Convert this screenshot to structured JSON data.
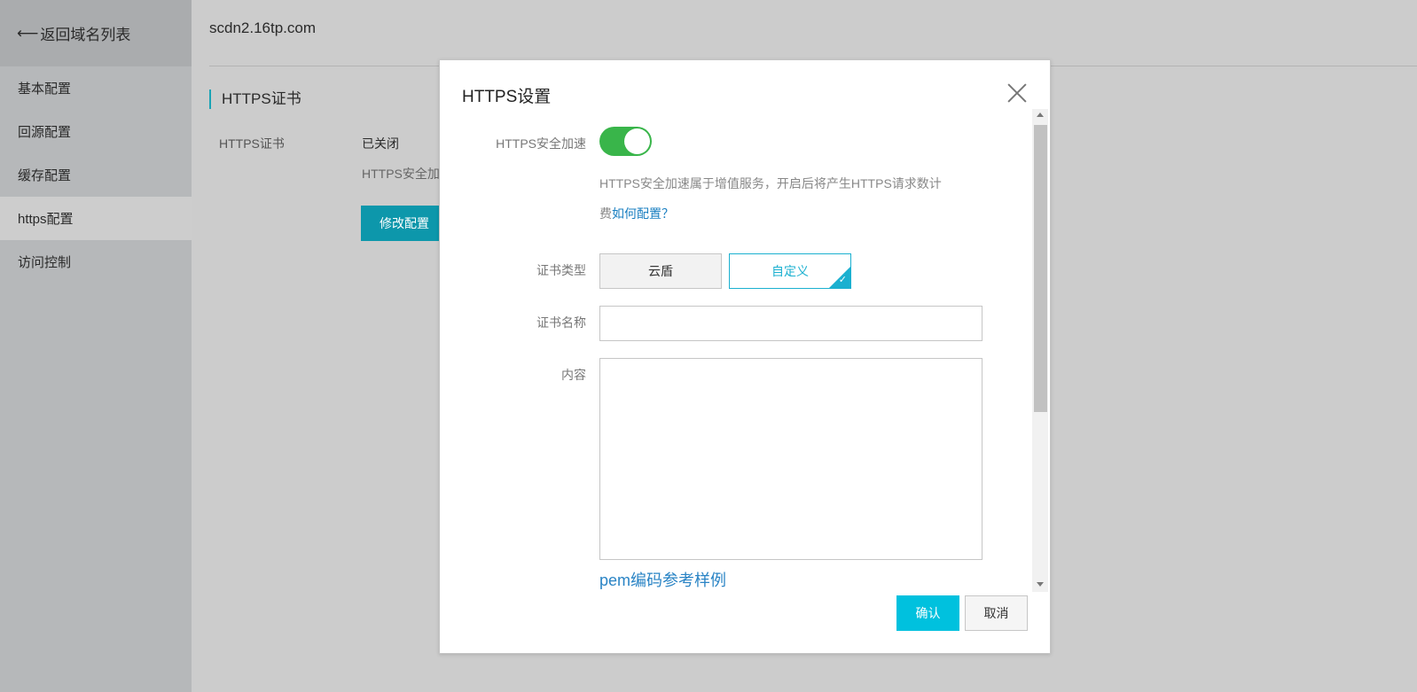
{
  "sidebar": {
    "back_arrow": "⟵",
    "back_label": "返回域名列表",
    "items": [
      {
        "label": "基本配置"
      },
      {
        "label": "回源配置"
      },
      {
        "label": "缓存配置"
      },
      {
        "label": "https配置"
      },
      {
        "label": "访问控制"
      }
    ],
    "active_index": 3
  },
  "main": {
    "domain": "scdn2.16tp.com",
    "section_title": "HTTPS证书",
    "row_label": "HTTPS证书",
    "row_value": "已关闭",
    "row_desc": "HTTPS安全加",
    "edit_button": "修改配置"
  },
  "modal": {
    "title": "HTTPS设置",
    "https_label": "HTTPS安全加速",
    "https_enabled": true,
    "help_text": "HTTPS安全加速属于增值服务，开启后将产生HTTPS请求数计费",
    "help_text_line1": "HTTPS安全加速属于增值服务，开启后将产生HTTPS请求数计",
    "help_text_line2": "费",
    "help_link": "如何配置？",
    "cert_type_label": "证书类型",
    "cert_type_options": [
      "云盾",
      "自定义"
    ],
    "cert_type_selected": "自定义",
    "cert_name_label": "证书名称",
    "cert_name_value": "",
    "content_label": "内容",
    "content_value": "",
    "pem_link": "pem编码参考样例",
    "confirm_button": "确认",
    "cancel_button": "取消"
  },
  "colors": {
    "accent": "#00c1de",
    "toggle_on": "#39b54a",
    "link": "#1a7fc1",
    "edit_button_bg": "#0d97ab"
  }
}
